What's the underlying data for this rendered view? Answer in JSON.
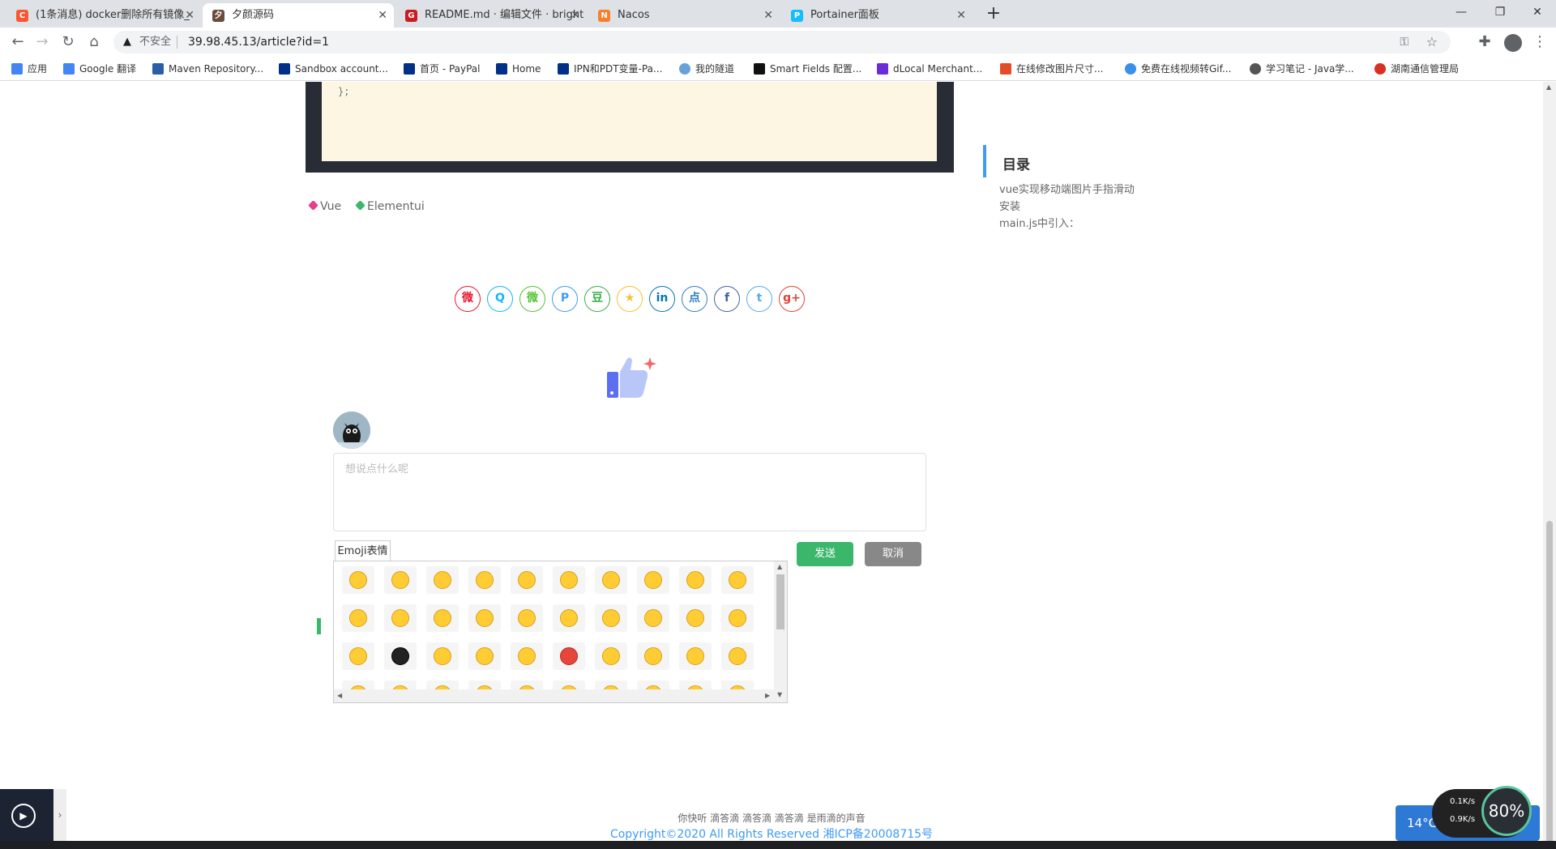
{
  "tabs": [
    {
      "title": "(1条消息) docker删除所有镜像_",
      "icon": "csdn-icon",
      "color": "#fc5531"
    },
    {
      "title": "夕颜源码",
      "icon": "site-icon",
      "color": "#6b4c3b"
    },
    {
      "title": "README.md · 编辑文件 · bright",
      "icon": "gitee-icon",
      "color": "#c71d23"
    },
    {
      "title": "Nacos",
      "icon": "nacos-icon",
      "color": "#f97f2a"
    },
    {
      "title": "Portainer面板",
      "icon": "portainer-icon",
      "color": "#13bef9"
    }
  ],
  "address": {
    "security": "不安全",
    "url": "39.98.45.13/article?id=1"
  },
  "bookmarks": [
    {
      "label": "应用",
      "color": "#4285f4"
    },
    {
      "label": "Google 翻译",
      "color": "#4285f4"
    },
    {
      "label": "Maven Repository...",
      "color": "#2b5ea7"
    },
    {
      "label": "Sandbox account...",
      "color": "#003087"
    },
    {
      "label": "首页 - PayPal",
      "color": "#003087"
    },
    {
      "label": "Home",
      "color": "#003087"
    },
    {
      "label": "IPN和PDT变量-Pa...",
      "color": "#003087"
    },
    {
      "label": "我的隧道",
      "color": "#6aa0d8"
    },
    {
      "label": "Smart Fields 配置...",
      "color": "#111111"
    },
    {
      "label": "dLocal Merchant...",
      "color": "#6c2bd9"
    },
    {
      "label": "在线修改图片尺寸...",
      "color": "#e34c26"
    },
    {
      "label": "免费在线视频转Gif...",
      "color": "#3b8eea"
    },
    {
      "label": "学习笔记 - Java学...",
      "color": "#555555"
    },
    {
      "label": "湖南通信管理局",
      "color": "#d93025"
    }
  ],
  "code": {
    "last_line": "};"
  },
  "tags": [
    {
      "label": "Vue",
      "color": "#e83e8c"
    },
    {
      "label": "Elementui",
      "color": "#3bb76c"
    }
  ],
  "toc": {
    "title": "目录",
    "items": [
      "vue实现移动端图片手指滑动",
      "安装",
      "main.js中引入："
    ]
  },
  "share": [
    {
      "name": "weibo-icon",
      "glyph": "微",
      "color": "#e6162d"
    },
    {
      "name": "qq-icon",
      "glyph": "Q",
      "color": "#12b7f5"
    },
    {
      "name": "wechat-icon",
      "glyph": "微",
      "color": "#51c332"
    },
    {
      "name": "qzone-icon",
      "glyph": "P",
      "color": "#3f9bf3"
    },
    {
      "name": "douban-icon",
      "glyph": "豆",
      "color": "#33b045"
    },
    {
      "name": "favorite-icon",
      "glyph": "★",
      "color": "#f8c02e"
    },
    {
      "name": "linkedin-icon",
      "glyph": "in",
      "color": "#0077b5"
    },
    {
      "name": "diandian-icon",
      "glyph": "点",
      "color": "#307dca"
    },
    {
      "name": "facebook-icon",
      "glyph": "f",
      "color": "#44619d"
    },
    {
      "name": "twitter-icon",
      "glyph": "t",
      "color": "#55acee"
    },
    {
      "name": "google-plus-icon",
      "glyph": "g+",
      "color": "#db4437"
    }
  ],
  "comment": {
    "placeholder": "想说点什么呢",
    "send": "发送",
    "cancel": "取消",
    "emoji_tab": "Emoji表情"
  },
  "footer": {
    "line1": "你快听 滴答滴 滴答滴 滴答滴 是雨滴的声音",
    "line2": "Copyright©2020 All Rights Reserved 湘ICP备20008715号"
  },
  "widgets": {
    "weather": "14°C 深圳",
    "gauge": "80%",
    "net_up": "0.1K/s",
    "net_down": "0.9K/s"
  },
  "colors": {
    "accent_blue": "#3f9bf3",
    "send_green": "#3bb76c",
    "cancel_gray": "#888888"
  }
}
